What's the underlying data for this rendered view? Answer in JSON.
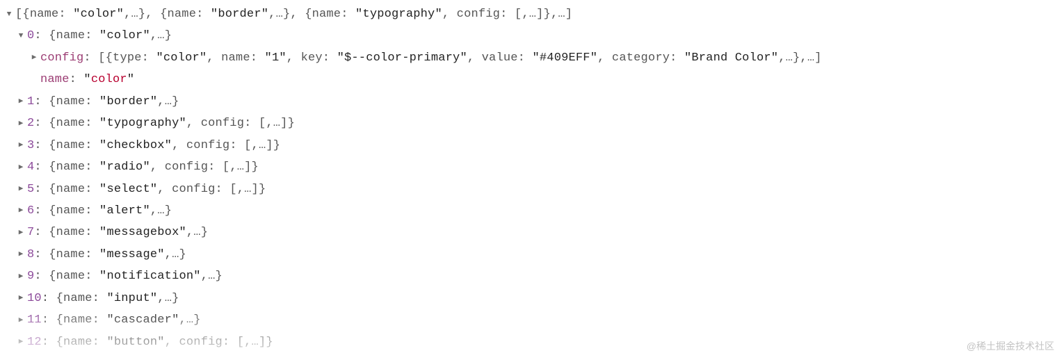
{
  "ellipsis": "…",
  "punct": {
    "colon": ":",
    "comma": ",",
    "lbrace": "{",
    "rbrace": "}",
    "lbrack": "[",
    "rbrack": "]",
    "space": " "
  },
  "labels": {
    "name": "name",
    "config": "config",
    "type": "type",
    "key": "key",
    "value": "value",
    "category": "category"
  },
  "root_summary": {
    "items": [
      {
        "name": "color",
        "tail": "ellipsis"
      },
      {
        "name": "border",
        "tail": "ellipsis"
      },
      {
        "name": "typography",
        "tail": "config_array"
      }
    ]
  },
  "expanded_item_index": "0",
  "expanded_item": {
    "name": "color",
    "config_preview": {
      "type": "color",
      "name": "1",
      "key": "$--color-primary",
      "value": "#409EFF",
      "category": "Brand Color"
    }
  },
  "items": [
    {
      "index": "1",
      "name": "border",
      "tail": "ellipsis"
    },
    {
      "index": "2",
      "name": "typography",
      "tail": "config_array"
    },
    {
      "index": "3",
      "name": "checkbox",
      "tail": "config_array"
    },
    {
      "index": "4",
      "name": "radio",
      "tail": "config_array"
    },
    {
      "index": "5",
      "name": "select",
      "tail": "config_array"
    },
    {
      "index": "6",
      "name": "alert",
      "tail": "ellipsis"
    },
    {
      "index": "7",
      "name": "messagebox",
      "tail": "ellipsis"
    },
    {
      "index": "8",
      "name": "message",
      "tail": "ellipsis"
    },
    {
      "index": "9",
      "name": "notification",
      "tail": "ellipsis"
    },
    {
      "index": "10",
      "name": "input",
      "tail": "ellipsis"
    },
    {
      "index": "11",
      "name": "cascader",
      "tail": "ellipsis"
    },
    {
      "index": "12",
      "name": "button",
      "tail": "config_array"
    }
  ],
  "watermark": "@稀土掘金技术社区"
}
